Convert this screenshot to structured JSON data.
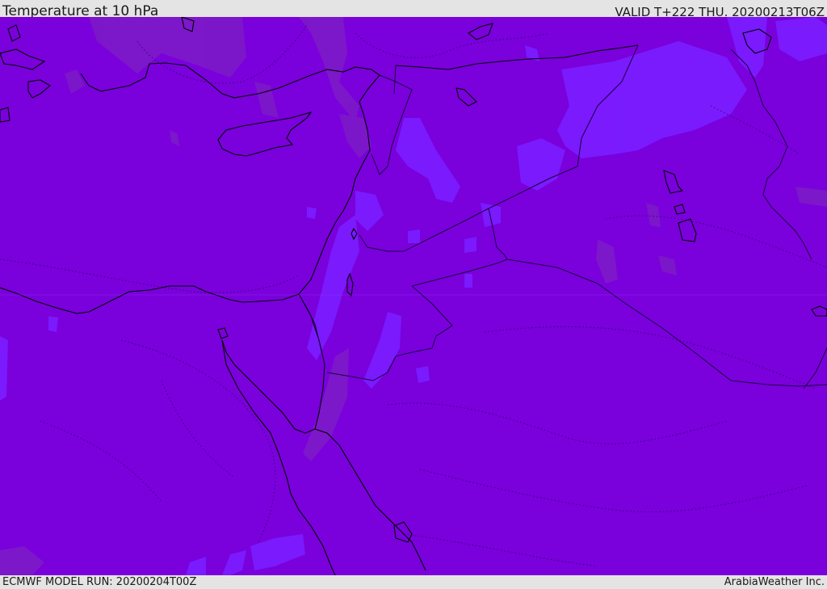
{
  "header": {
    "title": "Temperature at 10 hPa",
    "valid": "VALID T+222 THU. 20200213T06Z"
  },
  "footer": {
    "model_run": "ECMWF MODEL RUN: 20200204T00Z",
    "credit": "ArabiaWeather Inc."
  },
  "map": {
    "colors": {
      "background": "#7a00dc",
      "warmer_shade": "#7c19c8",
      "cooler_shade": "#7a1cff",
      "coastline": "#000000",
      "border": "#1a0040"
    },
    "region": "Eastern Mediterranean / Middle East"
  }
}
